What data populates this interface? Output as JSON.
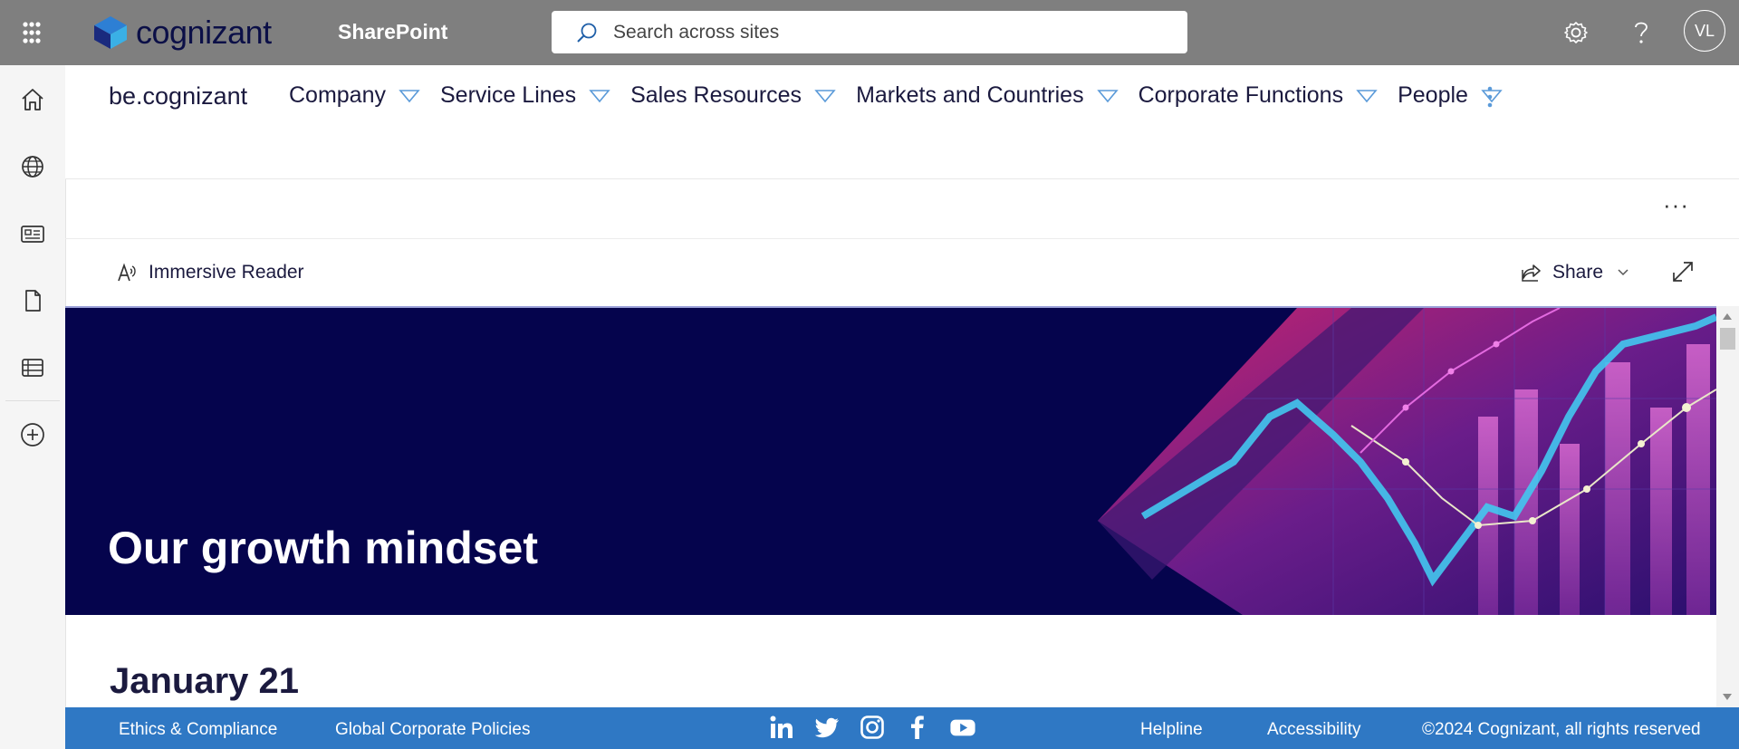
{
  "suitebar": {
    "app_name": "SharePoint",
    "logo_text": "cognizant",
    "search_placeholder": "Search across sites",
    "avatar_initials": "VL",
    "icons": [
      "waffle-icon",
      "gear-icon",
      "help-icon"
    ]
  },
  "appbar": {
    "icons": [
      "home-icon",
      "globe-icon",
      "news-icon",
      "file-icon",
      "list-icon",
      "add-icon"
    ]
  },
  "hubnav": {
    "site_title": "be.cognizant",
    "items": [
      {
        "label": "Company"
      },
      {
        "label": "Service Lines"
      },
      {
        "label": "Sales Resources"
      },
      {
        "label": "Markets and Countries"
      },
      {
        "label": "Corporate Functions"
      },
      {
        "label": "People"
      }
    ]
  },
  "commandbar": {
    "more_label": "···",
    "immersive_reader": "Immersive Reader",
    "share": "Share"
  },
  "hero": {
    "title": "Our growth mindset"
  },
  "content": {
    "date": "January 21"
  },
  "footer": {
    "links_left": [
      "Ethics & Compliance",
      "Global Corporate Policies"
    ],
    "social": [
      "linkedin-icon",
      "twitter-icon",
      "instagram-icon",
      "facebook-icon",
      "youtube-icon"
    ],
    "helpline": "Helpline",
    "accessibility": "Accessibility",
    "copyright": "©2024 Cognizant, all rights reserved"
  },
  "colors": {
    "suitebar_bg": "#7f7f7f",
    "hero_bg": "#05044d",
    "footer_bg": "#2f78c4",
    "nav_text": "#1b1a3f"
  }
}
